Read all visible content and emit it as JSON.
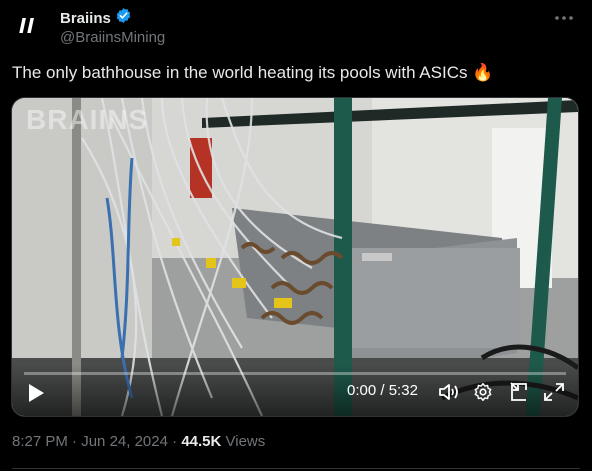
{
  "author": {
    "display_name": "Braiins",
    "handle": "@BraiinsMining",
    "verified": true,
    "avatar_glyph": "\\\\",
    "verified_color": "#1d9bf0"
  },
  "tweet": {
    "text": "The only bathhouse in the world heating its pools with ASICs",
    "emoji": "🔥"
  },
  "video": {
    "watermark": "BRAIINS",
    "current_time": "0:00",
    "duration": "5:32",
    "progress_fraction": 0,
    "controls": [
      "play-icon",
      "volume-icon",
      "settings-icon",
      "pip-icon",
      "fullscreen-icon"
    ]
  },
  "meta": {
    "time": "8:27 PM",
    "date": "Jun 24, 2024",
    "views_count": "44.5K",
    "views_label": "Views"
  }
}
